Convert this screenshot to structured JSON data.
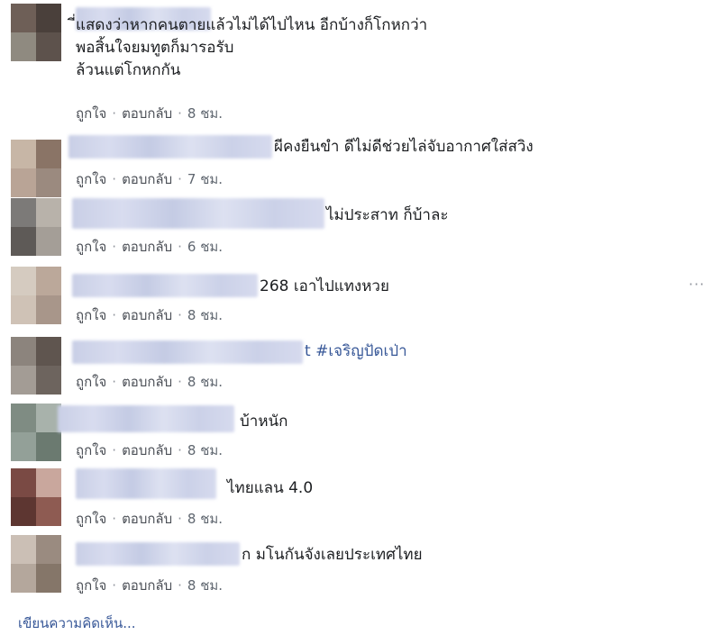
{
  "comments": [
    {
      "text": "ี่แสดงว่าหากคนตายแล้วไม่ได้ไปไหน อีกบ้างก็โกหกว่า\nพอสิ้นใจยมทูตก็มารอรับ\nล้วนแต่โกหกกัน",
      "like": "ถูกใจ",
      "reply": "ตอบกลับ",
      "time": "8 ชม."
    },
    {
      "text": "ผีคงยืนขำ ดีไม่ดีช่วยไล่จับอากาศใส่สวิง",
      "like": "ถูกใจ",
      "reply": "ตอบกลับ",
      "time": "7 ชม."
    },
    {
      "text": "ไม่ประสาท ก็บ้าละ",
      "like": "ถูกใจ",
      "reply": "ตอบกลับ",
      "time": "6 ชม."
    },
    {
      "text": "268 เอาไปแทงหวย",
      "like": "ถูกใจ",
      "reply": "ตอบกลับ",
      "time": "8 ชม."
    },
    {
      "text": "t #เจริญปัดเป่า",
      "like": "ถูกใจ",
      "reply": "ตอบกลับ",
      "time": "8 ชม."
    },
    {
      "text": "บ้าหนัก",
      "like": "ถูกใจ",
      "reply": "ตอบกลับ",
      "time": "8 ชม."
    },
    {
      "text": "ไทยแลน 4.0",
      "like": "ถูกใจ",
      "reply": "ตอบกลับ",
      "time": "8 ชม."
    },
    {
      "text": "ก มโนกันจังเลยประเทศไทย",
      "like": "ถูกใจ",
      "reply": "ตอบกลับ",
      "time": "8 ชม."
    }
  ],
  "more_options": "···",
  "write_comment": "เขียนความคิดเห็น...",
  "colors": {
    "text": "#1c1e21",
    "action_text": "#4b4f56",
    "meta_text": "#606770",
    "link": "#385898"
  }
}
